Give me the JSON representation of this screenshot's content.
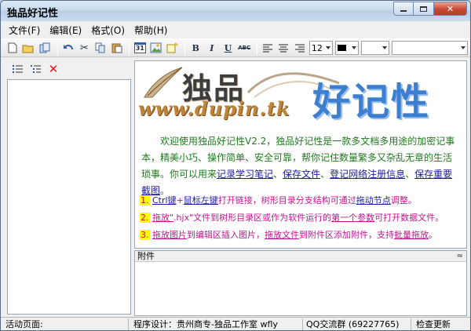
{
  "window": {
    "title": "独品好记性",
    "controls": [
      "minimize-icon",
      "maximize-icon",
      "close-icon"
    ]
  },
  "menu": [
    {
      "label": "文件(F)"
    },
    {
      "label": "编辑(E)"
    },
    {
      "label": "格式(O)"
    },
    {
      "label": "帮助(H)"
    }
  ],
  "toolbar": {
    "bold_label": "B",
    "italic_label": "I",
    "underline_label": "U",
    "strike_label": "ABC",
    "calendar_label": "31",
    "font_size": "12"
  },
  "banner": {
    "title_part1": "独品",
    "title_part2": "好记性",
    "url": "www.dupin.tk"
  },
  "intro": {
    "t1": "欢迎使用独品好记性V2.2，独品好记性是一款多文档多用途的加密记事本，精美小巧、操作简单、安全可靠，帮你记住数量繁多又杂乱无章的生活琐事。你可以用来",
    "link1": "记录学习笔记",
    "sep1": "、",
    "link2": "保存文件",
    "sep2": "、",
    "link3": "登记网络注册信息",
    "sep3": "、",
    "link4": "保存重要截图",
    "end": "。"
  },
  "tips": [
    {
      "num": "1.",
      "parts": [
        {
          "text": "Ctrl键",
          "link": true
        },
        {
          "text": "+",
          "link": false
        },
        {
          "text": "鼠标左键",
          "link": true
        },
        {
          "text": "打开链接，树形目录分支结构可通过",
          "link": false
        },
        {
          "text": "拖动节点",
          "link": true
        },
        {
          "text": "调整。",
          "link": false
        }
      ]
    },
    {
      "num": "2.",
      "parts": [
        {
          "text": "拖放\"",
          "link": true
        },
        {
          "text": ".hjx\"文件到树形目录区或作为软件运行的",
          "link": false
        },
        {
          "text": "第一个参数",
          "link": true
        },
        {
          "text": "可打开数据文件。",
          "link": false
        }
      ]
    },
    {
      "num": "3.",
      "parts": [
        {
          "text": "拖放图片",
          "link": true
        },
        {
          "text": "到编辑区插入图片，",
          "link": false
        },
        {
          "text": "拖放文件",
          "link": true
        },
        {
          "text": "到附件区添加附件，支持",
          "link": false
        },
        {
          "text": "批量拖放",
          "link": true
        },
        {
          "text": "。",
          "link": false
        }
      ]
    }
  ],
  "attachment": {
    "header": "附件",
    "toggle": "≈"
  },
  "status": {
    "active_page": "活动页面:",
    "designer": "程序设计：贵州商专-独品工作室 wfly",
    "qq": "QQ交流群 (69227765)",
    "update": "检查更新"
  },
  "colors": {
    "intro_text": "#1d7b1d",
    "tip_text": "#c0158e",
    "link": "#1b1b9e",
    "highlight": "#ffff00"
  }
}
